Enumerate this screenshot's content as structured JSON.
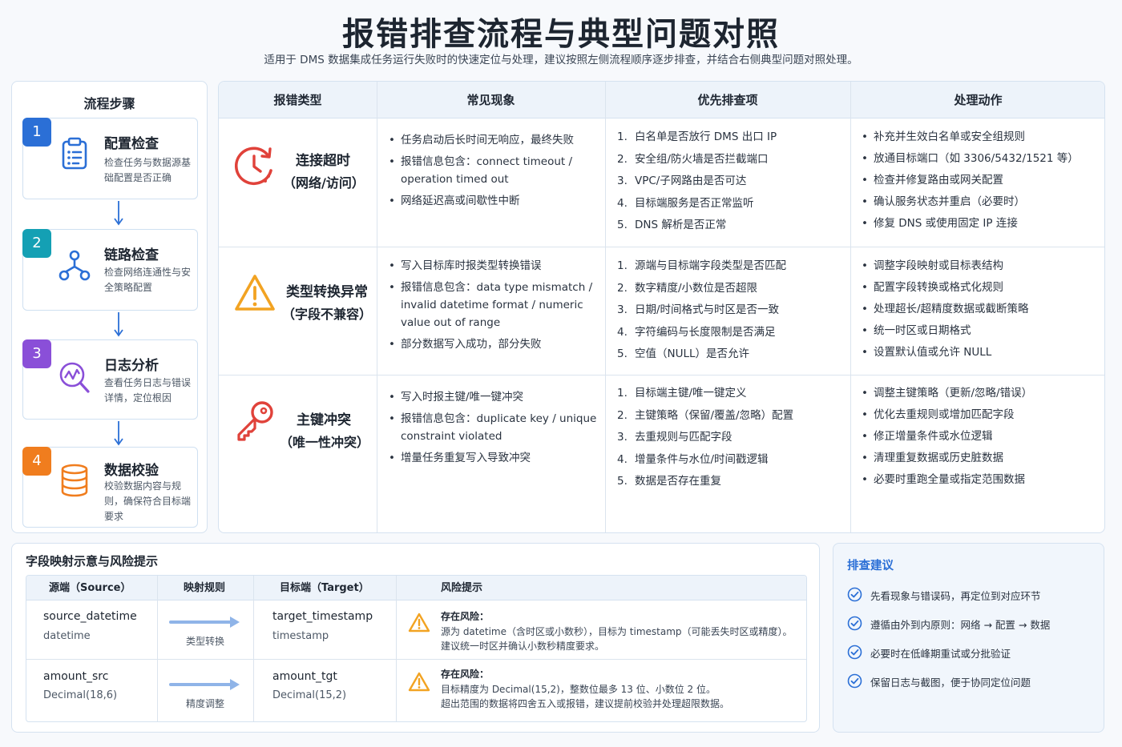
{
  "title": "报错排查流程与典型问题对照",
  "subtitle": "适用于 DMS 数据集成任务运行失败时的快速定位与处理，建议按照左侧流程顺序逐步排查，并结合右侧典型问题对照处理。",
  "steps_panel": {
    "title": "流程步骤",
    "steps": [
      {
        "num": "1",
        "title": "配置检查",
        "desc": "检查任务与数据源基础配置是否正确",
        "icon": "clipboard-icon",
        "color": "#2b6fd6"
      },
      {
        "num": "2",
        "title": "链路检查",
        "desc": "检查网络连通性与安全策略配置",
        "icon": "network-icon",
        "color": "#14a0b4"
      },
      {
        "num": "3",
        "title": "日志分析",
        "desc": "查看任务日志与错误详情，定位根因",
        "icon": "log-search-icon",
        "color": "#8a4fd8"
      },
      {
        "num": "4",
        "title": "数据校验",
        "desc": "校验数据内容与规则，确保符合目标端要求",
        "icon": "database-icon",
        "color": "#f07d1e"
      }
    ]
  },
  "table": {
    "headers": [
      "报错类型",
      "常见现象",
      "优先排查项",
      "处理动作"
    ],
    "rows": [
      {
        "type": "连接超时",
        "type_sub": "（网络/访问）",
        "icon": "clock-icon",
        "phenomena": [
          "任务启动后长时间无响应，最终失败",
          "报错信息包含：connect timeout / operation timed out",
          "网络延迟高或间歇性中断"
        ],
        "checks": [
          "白名单是否放行 DMS 出口 IP",
          "安全组/防火墙是否拦截端口",
          "VPC/子网路由是否可达",
          "目标端服务是否正常监听",
          "DNS 解析是否正常"
        ],
        "actions": [
          "补充并生效白名单或安全组规则",
          "放通目标端口（如 3306/5432/1521 等）",
          "检查并修复路由或网关配置",
          "确认服务状态并重启（必要时）",
          "修复 DNS 或使用固定 IP 连接"
        ]
      },
      {
        "type": "类型转换异常",
        "type_sub": "（字段不兼容）",
        "icon": "warning-icon",
        "phenomena": [
          "写入目标库时报类型转换错误",
          "报错信息包含：data type mismatch / invalid datetime format / numeric value out of range",
          "部分数据写入成功，部分失败"
        ],
        "checks": [
          "源端与目标端字段类型是否匹配",
          "数字精度/小数位是否超限",
          "日期/时间格式与时区是否一致",
          "字符编码与长度限制是否满足",
          "空值（NULL）是否允许"
        ],
        "actions": [
          "调整字段映射或目标表结构",
          "配置字段转换或格式化规则",
          "处理超长/超精度数据或截断策略",
          "统一时区或日期格式",
          "设置默认值或允许 NULL"
        ]
      },
      {
        "type": "主键冲突",
        "type_sub": "（唯一性冲突）",
        "icon": "key-icon",
        "phenomena": [
          "写入时报主键/唯一键冲突",
          "报错信息包含：duplicate key / unique constraint violated",
          "增量任务重复写入导致冲突"
        ],
        "checks": [
          "目标端主键/唯一键定义",
          "主键策略（保留/覆盖/忽略）配置",
          "去重规则与匹配字段",
          "增量条件与水位/时间戳逻辑",
          "数据是否存在重复"
        ],
        "actions": [
          "调整主键策略（更新/忽略/错误）",
          "优化去重规则或增加匹配字段",
          "修正增量条件或水位逻辑",
          "清理重复数据或历史脏数据",
          "必要时重跑全量或指定范围数据"
        ]
      }
    ]
  },
  "mapping": {
    "title": "字段映射示意与风险提示",
    "headers": [
      "源端（Source）",
      "映射规则",
      "目标端（Target）",
      "风险提示"
    ],
    "rows": [
      {
        "source_field": "source_datetime",
        "source_type": "datetime",
        "rule": "类型转换",
        "target_field": "target_timestamp",
        "target_type": "timestamp",
        "risk_title": "存在风险：",
        "risk_lines": [
          "源为 datetime（含时区或小数秒），目标为 timestamp（可能丢失时区或精度）。",
          "建议统一时区并确认小数秒精度要求。"
        ]
      },
      {
        "source_field": "amount_src",
        "source_type": "Decimal(18,6)",
        "rule": "精度调整",
        "target_field": "amount_tgt",
        "target_type": "Decimal(15,2)",
        "risk_title": "存在风险：",
        "risk_lines": [
          "目标精度为 Decimal(15,2)，整数位最多 13 位、小数位 2 位。",
          "超出范围的数据将四舍五入或报错，建议提前校验并处理超限数据。"
        ]
      }
    ]
  },
  "suggestions": {
    "title": "排查建议",
    "items": [
      "先看现象与错误码，再定位到对应环节",
      "遵循由外到内原则：网络 → 配置 → 数据",
      "必要时在低峰期重试或分批验证",
      "保留日志与截图，便于协同定位问题"
    ]
  },
  "colors": {
    "accent_blue": "#2b6fd6",
    "danger_red": "#e0423a",
    "warning_orange": "#f2a322",
    "arrow_blue": "#8fb4e8"
  }
}
